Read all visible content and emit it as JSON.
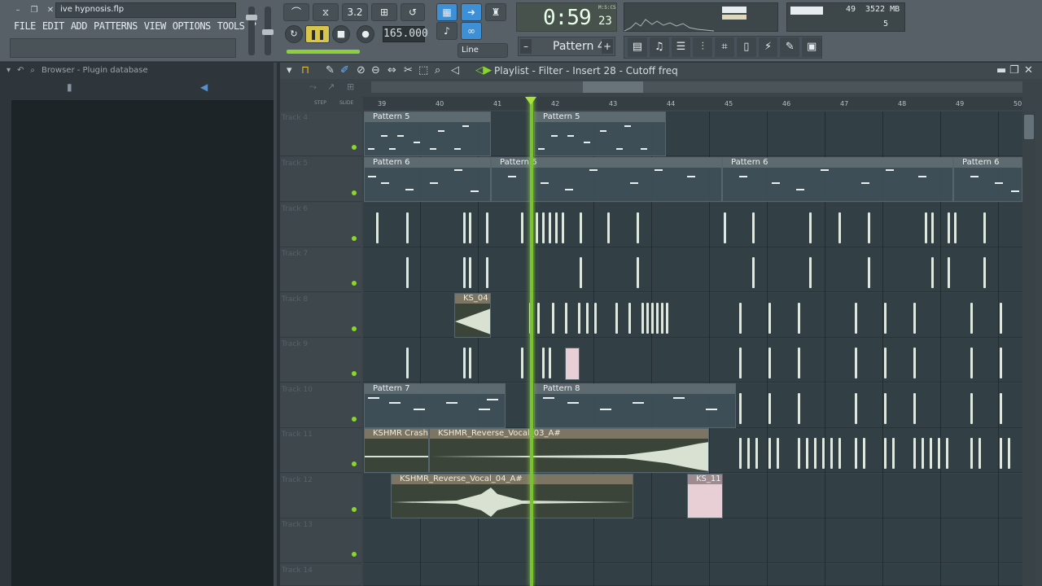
{
  "window": {
    "filename": "ive hypnosis.flp",
    "minimize": "–",
    "restore": "❐",
    "close": "✕"
  },
  "menu": [
    "FILE",
    "EDIT",
    "ADD",
    "PATTERNS",
    "VIEW",
    "OPTIONS",
    "TOOLS",
    "?"
  ],
  "transport": {
    "bpm": "165.000",
    "time_main": "0:59",
    "time_sub": "23",
    "time_unit": "M:S:CS",
    "snap": "Line",
    "pattern": "Pattern 4"
  },
  "cpu": {
    "value1": "49",
    "memory": "3522 MB",
    "poly": "5"
  },
  "browser": {
    "title": "Browser - Plugin database"
  },
  "playlist": {
    "title": "Playlist - Filter - Insert 28 - Cutoff freq",
    "step_label": "STEP",
    "slide_label": "SLIDE"
  },
  "ruler": [
    "39",
    "40",
    "41",
    "42",
    "43",
    "44",
    "45",
    "46",
    "47",
    "48",
    "49",
    "50"
  ],
  "tracks": [
    "Track 4",
    "Track 5",
    "Track 6",
    "Track 7",
    "Track 8",
    "Track 9",
    "Track 10",
    "Track 11",
    "Track 12",
    "Track 13",
    "Track 14"
  ],
  "clips": {
    "p5a": "Pattern 5",
    "p5b": "Pattern 5",
    "p6a": "Pattern 6",
    "p6b": "Pattern 6",
    "p6c": "Pattern 6",
    "p6d": "Pattern 6",
    "p7": "Pattern 7",
    "p8": "Pattern 8",
    "ks04": "KS_04",
    "crash": "KSHMR Crash",
    "rev03": "KSHMR_Reverse_Vocal_03_A#",
    "rev04": "KSHMR_Reverse_Vocal_04_A#",
    "ks11": "KS_11"
  },
  "colors": {
    "playhead": "#79c42e",
    "accent": "#3d8fd6",
    "track_led": "#8ad629"
  }
}
